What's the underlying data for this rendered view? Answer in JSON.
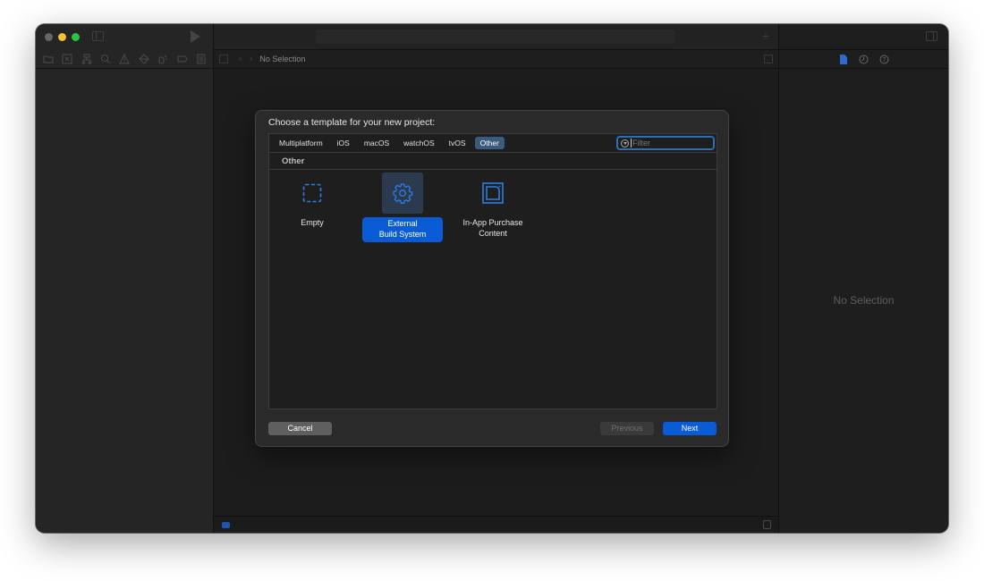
{
  "window": {
    "jumpbar_title": "No Selection",
    "inspector_empty": "No Selection",
    "navigator_icons": [
      "folder-icon",
      "source-control-icon",
      "hierarchy-icon",
      "search-icon",
      "warning-icon",
      "test-icon",
      "debug-icon",
      "breakpoint-icon",
      "report-icon"
    ],
    "inspector_tabs": [
      "file-inspector-icon",
      "history-icon",
      "help-icon"
    ],
    "accent_color": "#0a5bd6"
  },
  "dialog": {
    "title": "Choose a template for your new project:",
    "tabs": [
      {
        "label": "Multiplatform",
        "active": false
      },
      {
        "label": "iOS",
        "active": false
      },
      {
        "label": "macOS",
        "active": false
      },
      {
        "label": "watchOS",
        "active": false
      },
      {
        "label": "tvOS",
        "active": false
      },
      {
        "label": "Other",
        "active": true
      }
    ],
    "filter": {
      "placeholder": "Filter",
      "value": ""
    },
    "section": "Other",
    "templates": [
      {
        "label": "Empty",
        "icon": "empty-template-icon",
        "selected": false
      },
      {
        "label": "External\nBuild System",
        "label_lines": [
          "External",
          "Build System"
        ],
        "icon": "gear-icon",
        "selected": true
      },
      {
        "label": "In-App Purchase\nContent",
        "label_lines": [
          "In-App Purchase",
          "Content"
        ],
        "icon": "in-app-purchase-icon",
        "selected": false
      }
    ],
    "buttons": {
      "cancel": "Cancel",
      "previous": "Previous",
      "next": "Next"
    }
  }
}
